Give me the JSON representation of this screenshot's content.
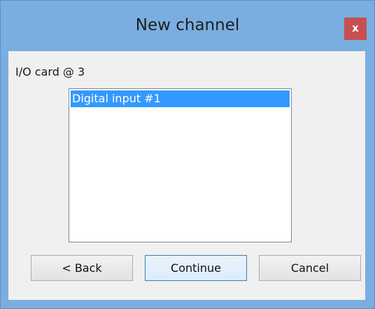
{
  "window": {
    "title": "New channel",
    "close_label": "x"
  },
  "main": {
    "card_label": "I/O card @ 3",
    "list_items": [
      "Digital input #1"
    ],
    "selected_index": 0
  },
  "buttons": {
    "back": "< Back",
    "continue": "Continue",
    "cancel": "Cancel"
  },
  "colors": {
    "frame": "#7aaee0",
    "close": "#c7504f",
    "selection": "#3399ff"
  }
}
